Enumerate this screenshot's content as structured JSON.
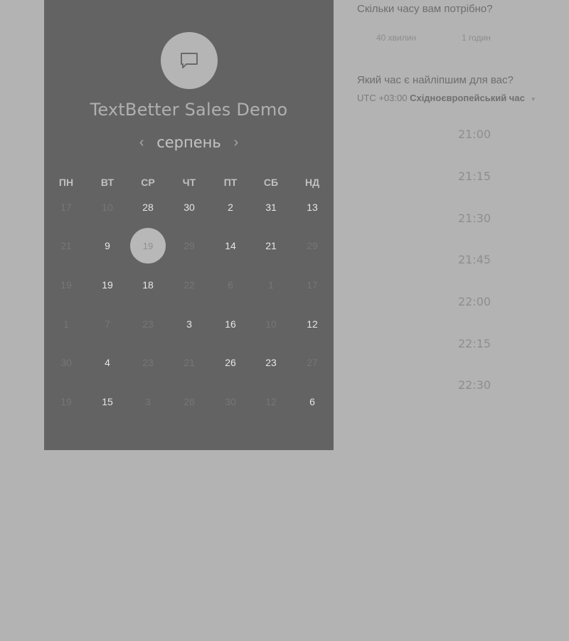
{
  "calendar": {
    "title": "TextBetter Sales Demo",
    "month": "серпень",
    "prev_icon": "‹",
    "next_icon": "›",
    "weekdays": [
      "ПН",
      "ВТ",
      "СР",
      "ЧТ",
      "ПТ",
      "СБ",
      "НД"
    ],
    "weeks": [
      [
        {
          "d": "17",
          "s": "m"
        },
        {
          "d": "10",
          "s": "m"
        },
        {
          "d": "28",
          "s": "a"
        },
        {
          "d": "30",
          "s": "a"
        },
        {
          "d": "2",
          "s": "a"
        },
        {
          "d": "31",
          "s": "a"
        },
        {
          "d": "13",
          "s": "a"
        }
      ],
      [
        {
          "d": "21",
          "s": "m"
        },
        {
          "d": "9",
          "s": "a"
        },
        {
          "d": "19",
          "s": "sel"
        },
        {
          "d": "29",
          "s": "m"
        },
        {
          "d": "14",
          "s": "a"
        },
        {
          "d": "21",
          "s": "a"
        },
        {
          "d": "29",
          "s": "m"
        }
      ],
      [
        {
          "d": "19",
          "s": "m"
        },
        {
          "d": "19",
          "s": "a"
        },
        {
          "d": "18",
          "s": "a"
        },
        {
          "d": "22",
          "s": "m"
        },
        {
          "d": "6",
          "s": "m"
        },
        {
          "d": "1",
          "s": "m"
        },
        {
          "d": "17",
          "s": "m"
        }
      ],
      [
        {
          "d": "1",
          "s": "m"
        },
        {
          "d": "7",
          "s": "m"
        },
        {
          "d": "23",
          "s": "m"
        },
        {
          "d": "3",
          "s": "a"
        },
        {
          "d": "16",
          "s": "a"
        },
        {
          "d": "10",
          "s": "m"
        },
        {
          "d": "12",
          "s": "a"
        }
      ],
      [
        {
          "d": "30",
          "s": "m"
        },
        {
          "d": "4",
          "s": "a"
        },
        {
          "d": "23",
          "s": "m"
        },
        {
          "d": "21",
          "s": "m"
        },
        {
          "d": "26",
          "s": "a"
        },
        {
          "d": "23",
          "s": "a"
        },
        {
          "d": "27",
          "s": "m"
        }
      ],
      [
        {
          "d": "19",
          "s": "m"
        },
        {
          "d": "15",
          "s": "a"
        },
        {
          "d": "3",
          "s": "m"
        },
        {
          "d": "26",
          "s": "m"
        },
        {
          "d": "30",
          "s": "m"
        },
        {
          "d": "12",
          "s": "m"
        },
        {
          "d": "6",
          "s": "a"
        }
      ]
    ]
  },
  "duration": {
    "question": "Скільки часу вам потрібно?",
    "options": [
      "40 хвилин",
      "1 годин"
    ]
  },
  "time": {
    "question": "Який час є найліпшим для вас?",
    "tz_prefix": "UTC +03:00",
    "tz_name": "Східноєвропейський час",
    "tz_caret": "▾",
    "slots": [
      "21:00",
      "21:15",
      "21:30",
      "21:45",
      "22:00",
      "22:15",
      "22:30"
    ]
  },
  "colors": {
    "page_bg": "#b3b3b3",
    "panel_bg": "#636363",
    "selected_day_bg": "#b8b8b8"
  },
  "icons": {
    "logo": "chat-bubble-icon"
  }
}
